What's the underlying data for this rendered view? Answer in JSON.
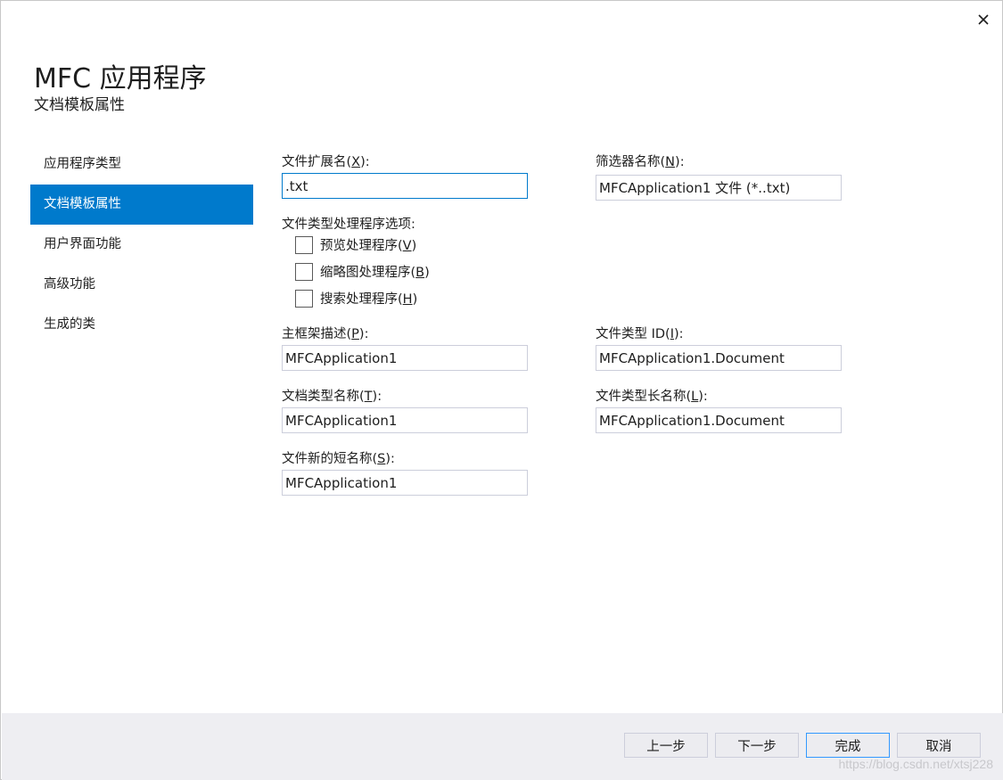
{
  "window": {
    "close_icon": "close-icon"
  },
  "header": {
    "title": "MFC 应用程序",
    "subtitle": "文档模板属性"
  },
  "sidebar": {
    "items": [
      {
        "label": "应用程序类型",
        "active": false
      },
      {
        "label": "文档模板属性",
        "active": true
      },
      {
        "label": "用户界面功能",
        "active": false
      },
      {
        "label": "高级功能",
        "active": false
      },
      {
        "label": "生成的类",
        "active": false
      }
    ]
  },
  "form": {
    "file_ext": {
      "label_pre": "文件扩展名(",
      "label_key": "X",
      "label_post": "):",
      "value": ".txt"
    },
    "filter_name": {
      "label_pre": "筛选器名称(",
      "label_key": "N",
      "label_post": "):",
      "value": "MFCApplication1 文件 (*..txt)"
    },
    "handler_options": {
      "label": "文件类型处理程序选项:",
      "preview": {
        "label_pre": "预览处理程序(",
        "label_key": "V",
        "label_post": ")",
        "checked": false
      },
      "thumbnail": {
        "label_pre": "缩略图处理程序(",
        "label_key": "B",
        "label_post": ")",
        "checked": false
      },
      "search": {
        "label_pre": "搜索处理程序(",
        "label_key": "H",
        "label_post": ")",
        "checked": false
      }
    },
    "main_frame": {
      "label_pre": "主框架描述(",
      "label_key": "P",
      "label_post": "):",
      "value": "MFCApplication1"
    },
    "file_type_id": {
      "label_pre": "文件类型 ID(",
      "label_key": "I",
      "label_post": "):",
      "value": "MFCApplication1.Document"
    },
    "doc_type_name": {
      "label_pre": "文档类型名称(",
      "label_key": "T",
      "label_post": "):",
      "value": "MFCApplication1"
    },
    "file_type_long": {
      "label_pre": "文件类型长名称(",
      "label_key": "L",
      "label_post": "):",
      "value": "MFCApplication1.Document"
    },
    "file_new_short": {
      "label_pre": "文件新的短名称(",
      "label_key": "S",
      "label_post": "):",
      "value": "MFCApplication1"
    }
  },
  "footer": {
    "prev_label": "上一步",
    "next_label": "下一步",
    "finish_label": "完成",
    "cancel_label": "取消",
    "watermark": "https://blog.csdn.net/xtsj228"
  },
  "colors": {
    "accent": "#007acc",
    "footer_bg": "#eeeef2"
  }
}
